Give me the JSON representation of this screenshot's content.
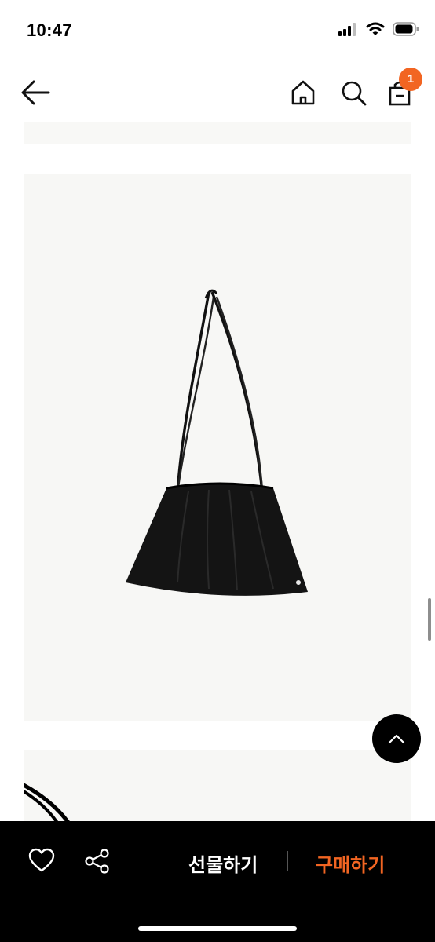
{
  "status_bar": {
    "time": "10:47"
  },
  "header": {
    "cart_count": "1",
    "accent": "#f26522"
  },
  "icons": {
    "back": "arrow-left-icon",
    "home": "home-icon",
    "search": "search-icon",
    "cart": "shopping-bag-icon",
    "scroll_top": "chevron-up-icon",
    "wishlist": "heart-icon",
    "share": "share-icon"
  },
  "bottom_bar": {
    "gift_label": "선물하기",
    "buy_label": "구매하기",
    "buy_color": "#f26522"
  }
}
